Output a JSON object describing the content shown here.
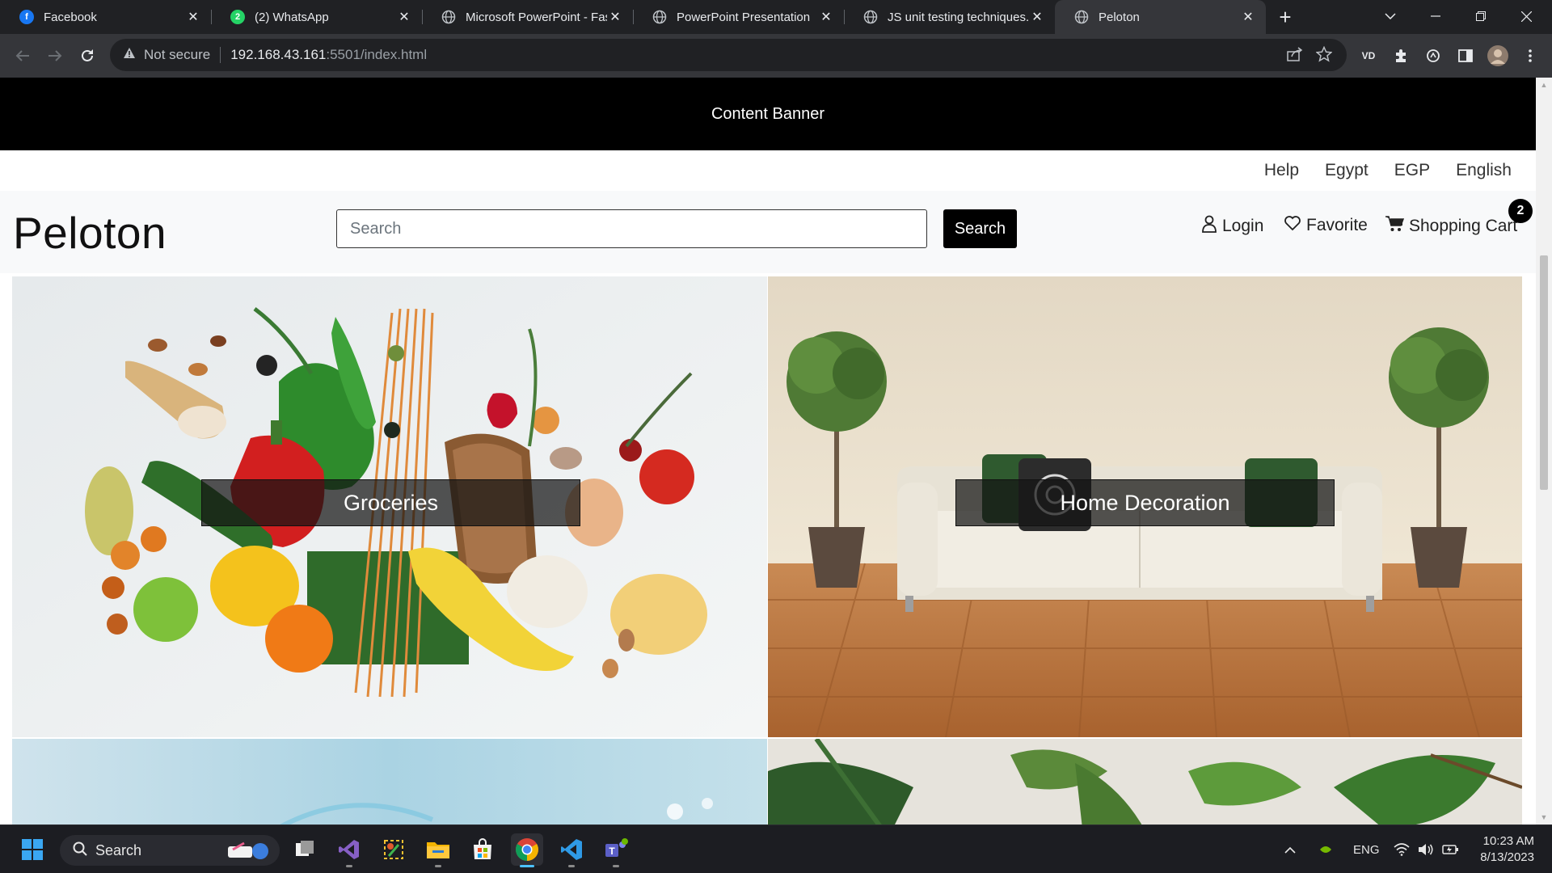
{
  "browser": {
    "tabs": [
      {
        "title": "Facebook",
        "icon": "facebook-icon",
        "color": "#1877f2",
        "active": false
      },
      {
        "title": "(2) WhatsApp",
        "icon": "whatsapp-icon",
        "color": "#25d366",
        "badge": "2",
        "active": false
      },
      {
        "title": "Microsoft PowerPoint - Fast",
        "icon": "globe-icon",
        "active": false
      },
      {
        "title": "PowerPoint Presentation",
        "icon": "globe-icon",
        "active": false
      },
      {
        "title": "JS unit testing techniques.p",
        "icon": "globe-icon",
        "active": false
      },
      {
        "title": "Peloton",
        "icon": "globe-icon",
        "active": true
      }
    ],
    "address": {
      "security_text": "Not secure",
      "host": "192.168.43.161",
      "path": ":5501/index.html"
    },
    "extension_label": "VD"
  },
  "page": {
    "banner": "Content Banner",
    "topnav": [
      "Help",
      "Egypt",
      "EGP",
      "English"
    ],
    "logo": "Peloton",
    "search": {
      "placeholder": "Search",
      "button": "Search"
    },
    "header_links": {
      "login": "Login",
      "favorite": "Favorite",
      "cart": "Shopping Cart"
    },
    "cart_count": "2",
    "categories": [
      {
        "label": "Groceries"
      },
      {
        "label": "Home Decoration"
      }
    ]
  },
  "taskbar": {
    "search_label": "Search",
    "language": "ENG",
    "time": "10:23 AM",
    "date": "8/13/2023",
    "apps": [
      "start",
      "search",
      "task-view",
      "visual-studio",
      "snipping-tool",
      "file-explorer",
      "microsoft-store",
      "chrome",
      "vscode",
      "teams"
    ]
  }
}
